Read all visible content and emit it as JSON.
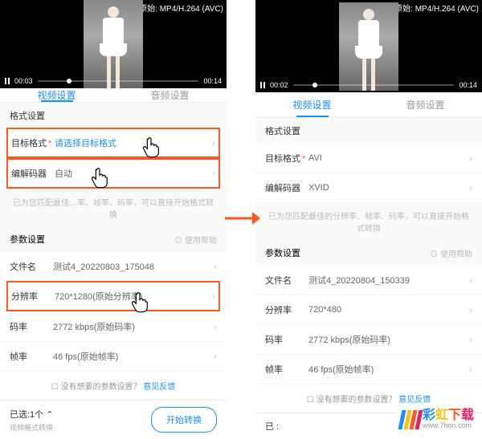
{
  "video": {
    "format_label": "原始: MP4/H.264 (AVC)",
    "time_current_left": "00:03",
    "time_current_right": "00:02",
    "time_total": "00:14"
  },
  "tabs": {
    "video": "视频设置",
    "audio": "音频设置"
  },
  "sections": {
    "format": "格式设置",
    "params": "参数设置"
  },
  "labels": {
    "target_format": "目标格式",
    "codec": "编解码器",
    "filename": "文件名",
    "resolution": "分辨率",
    "bitrate": "码率",
    "framerate": "帧率",
    "help": "⊙ 使用帮助"
  },
  "left_values": {
    "target_format": "请选择目标格式",
    "codec": "自动",
    "filename": "测试4_20220803_175048",
    "resolution": "720*1280(原始分辨率)",
    "bitrate": "2772 kbps(原始码率)",
    "framerate": "46 fps(原始帧率)"
  },
  "right_values": {
    "target_format": "AVI",
    "codec": "XVID",
    "filename": "测试4_20220804_150339",
    "resolution": "720*480",
    "bitrate": "2772 kbps(原始码率)",
    "framerate": "46 fps(原始帧率)"
  },
  "tip": "已为您匹配最佳的分辨率、帧率、码率，可以直接开始格式转换",
  "tip_left_partial": "已为您匹配最佳…率、帧率、码率，可以直接开始格式转换",
  "feedback": {
    "prefix": "☐ 没有想要的参数设置？",
    "link": "意见反馈"
  },
  "footer": {
    "selected": "已选:1个 ⌃",
    "selected_prefix": "已 :",
    "sub": "视频格式转换",
    "convert": "开始转换"
  },
  "logo": {
    "main": "彩虹下载",
    "sub": "www.7hon.com"
  }
}
